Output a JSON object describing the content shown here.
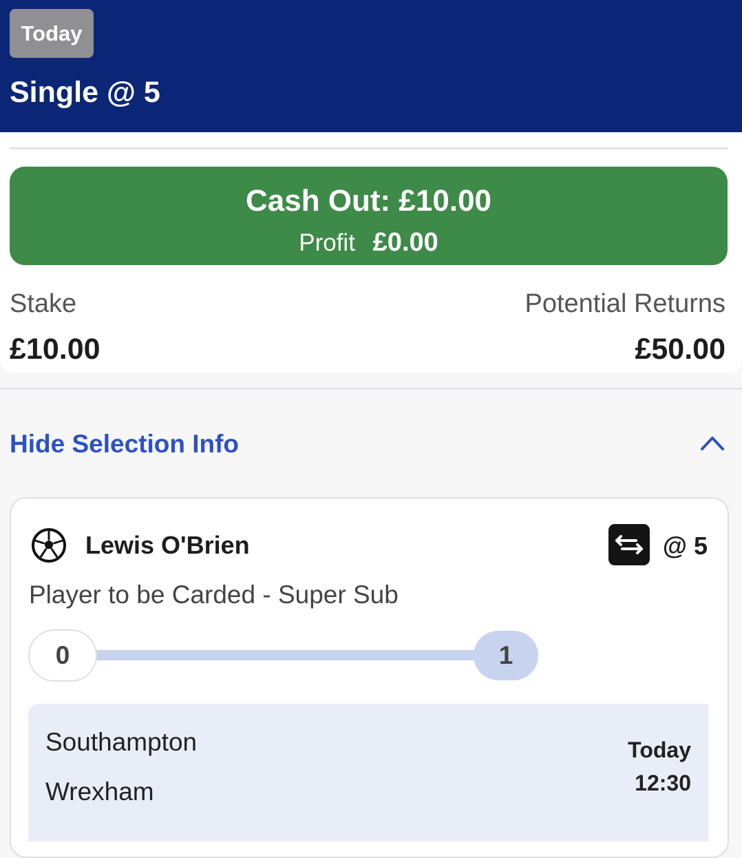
{
  "header": {
    "date_badge": "Today",
    "bet_title": "Single @ 5"
  },
  "cashout": {
    "label": "Cash Out: £10.00",
    "profit_label": "Profit",
    "profit_value": "£0.00"
  },
  "bet_summary": {
    "stake_label": "Stake",
    "stake_value": "£10.00",
    "returns_label": "Potential Returns",
    "returns_value": "£50.00"
  },
  "selection_toggle": {
    "label": "Hide Selection Info",
    "icon": "chevron-up-icon"
  },
  "selection": {
    "sport_icon": "football-icon",
    "player_name": "Lewis O'Brien",
    "swap_icon": "swap-icon",
    "odds": "@ 5",
    "market": "Player to be Carded - Super Sub",
    "progress": {
      "start_value": "0",
      "end_value": "1",
      "fraction_complete": 1.0
    },
    "event": {
      "home_team": "Southampton",
      "away_team": "Wrexham",
      "day": "Today",
      "time": "12:30"
    }
  },
  "colors": {
    "header_bg": "#0c2677",
    "cashout_bg": "#3e8a48",
    "link_blue": "#2c52c3",
    "progress_fill": "#c8d3ef"
  }
}
